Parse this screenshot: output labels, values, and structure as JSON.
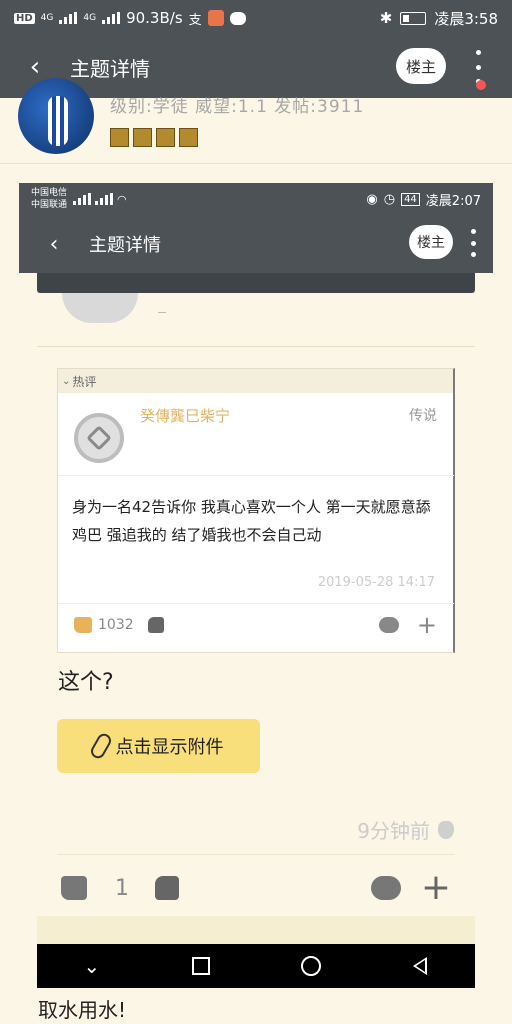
{
  "status_bar": {
    "hd": "HD",
    "network1": "4G",
    "network2": "4G",
    "speed": "90.3B/s",
    "time": "凌晨3:58"
  },
  "header": {
    "title": "主题详情",
    "owner_label": "楼主"
  },
  "author": {
    "meta": "级别:学徒   威望:1.1   发帖:3911"
  },
  "embedded": {
    "status_bar": {
      "carrier1": "中国电信",
      "carrier2": "中国联通",
      "battery": "44",
      "time": "凌晨2:07"
    },
    "header": {
      "title": "主题详情",
      "owner_label": "楼主"
    },
    "hot_comment": {
      "section_label": "热评",
      "username": "癸傳龔巳柴宁",
      "level": "传说",
      "text": "身为一名42告诉你 我真心喜欢一个人 第一天就愿意舔鸡巴 强追我的 结了婚我也不会自己动",
      "time": "2019-05-28 14:17",
      "likes": "1032"
    },
    "reply": {
      "text": "这个?",
      "attach_label": "点击显示附件",
      "time": "9分钟前",
      "likes": "1"
    }
  },
  "bottom_text": "取水用水!"
}
